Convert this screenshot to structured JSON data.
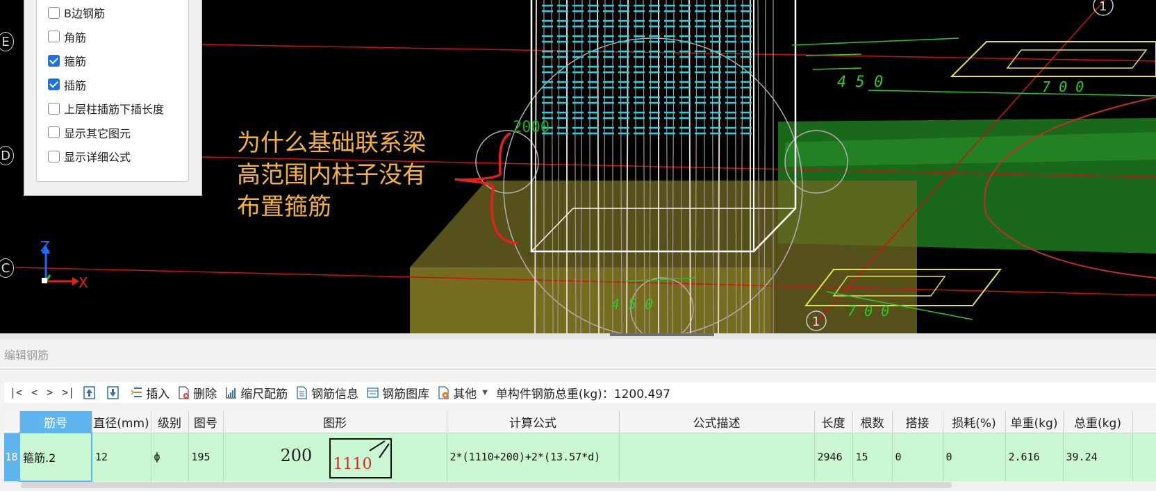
{
  "filter_panel": {
    "items": [
      {
        "label": "B边钢筋",
        "checked": false
      },
      {
        "label": "角筋",
        "checked": false
      },
      {
        "label": "箍筋",
        "checked": true
      },
      {
        "label": "插筋",
        "checked": true
      },
      {
        "label": "上层柱插筋下插长度",
        "checked": false
      },
      {
        "label": "显示其它图元",
        "checked": false
      },
      {
        "label": "显示详细公式",
        "checked": false
      }
    ]
  },
  "annotation": {
    "line1": "为什么基础联系梁",
    "line2": "高范围内柱子没有",
    "line3": "布置箍筋"
  },
  "axes": {
    "grid_labels": [
      "E",
      "D",
      "C"
    ],
    "marker_1": "1",
    "z": "Z",
    "x": "X"
  },
  "drawing_labels": {
    "dim_450_top": "4 5 0",
    "dim_700_top": "7 0 0",
    "dim_700_bottom": "7 0 0",
    "dim_450_bottom": "4 5 0",
    "num_2000": "2000",
    "num_1110": "1110",
    "num_200": "200"
  },
  "panel": {
    "title": "编辑钢筋",
    "toolbar": {
      "nav": [
        "|<",
        "<",
        ">",
        ">|"
      ],
      "insert": "插入",
      "delete": "删除",
      "scale": "缩尺配筋",
      "info": "钢筋信息",
      "library": "钢筋图库",
      "other": "其他",
      "total": "单构件钢筋总重(kg)：1200.497"
    },
    "columns": [
      "筋号",
      "直径(mm)",
      "级别",
      "图号",
      "图形",
      "计算公式",
      "公式描述",
      "长度",
      "根数",
      "搭接",
      "损耗(%)",
      "单重(kg)",
      "总重(kg)"
    ],
    "row": {
      "index": "18",
      "name": "箍筋.2",
      "diameter": "12",
      "grade": "ф",
      "figure_no": "195",
      "shape_left": "200",
      "shape_box": "1110",
      "formula": "2*(1110+200)+2*(13.57*d)",
      "description": "",
      "length": "2946",
      "count": "15",
      "lap": "0",
      "loss": "0",
      "unit_weight": "2.616",
      "total_weight": "39.24"
    }
  },
  "colors": {
    "accent": "#5eb5f0",
    "row_bg": "#c9f7d2",
    "annotation": "#f5b335",
    "cyan_rebar": "#19d8e8"
  }
}
